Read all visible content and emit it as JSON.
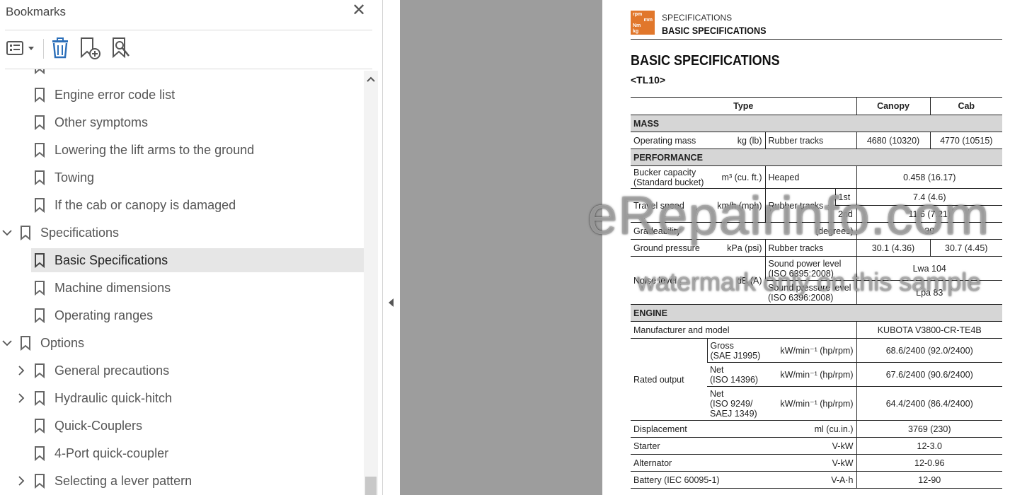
{
  "bookmarks_panel": {
    "title": "Bookmarks",
    "close_icon": "close-icon",
    "toolbar": {
      "options_icon": "list-options-icon",
      "delete_icon": "trash-icon",
      "new_bookmark_icon": "bookmark-add-icon",
      "bookmark_search_icon": "bookmark-search-icon"
    },
    "items": [
      {
        "label": "Engine error code list",
        "level": 1,
        "expander": "none",
        "selected": false
      },
      {
        "label": "Other symptoms",
        "level": 1,
        "expander": "none",
        "selected": false
      },
      {
        "label": "Lowering the lift arms to the ground",
        "level": 1,
        "expander": "none",
        "selected": false
      },
      {
        "label": "Towing",
        "level": 1,
        "expander": "none",
        "selected": false
      },
      {
        "label": "If the cab or canopy is damaged",
        "level": 1,
        "expander": "none",
        "selected": false
      },
      {
        "label": "Specifications",
        "level": 0,
        "expander": "expanded",
        "selected": false
      },
      {
        "label": "Basic Specifications",
        "level": 1,
        "expander": "none",
        "selected": true
      },
      {
        "label": "Machine dimensions",
        "level": 1,
        "expander": "none",
        "selected": false
      },
      {
        "label": "Operating ranges",
        "level": 1,
        "expander": "none",
        "selected": false
      },
      {
        "label": "Options",
        "level": 0,
        "expander": "expanded",
        "selected": false
      },
      {
        "label": "General precautions",
        "level": 1,
        "expander": "collapsed",
        "selected": false
      },
      {
        "label": "Hydraulic quick-hitch",
        "level": 1,
        "expander": "collapsed",
        "selected": false
      },
      {
        "label": "Quick-Couplers",
        "level": 1,
        "expander": "none",
        "selected": false
      },
      {
        "label": "4-Port quick-coupler",
        "level": 1,
        "expander": "none",
        "selected": false
      },
      {
        "label": "Selecting a lever pattern",
        "level": 1,
        "expander": "collapsed",
        "selected": false
      }
    ]
  },
  "colors": {
    "canvas_gray": "#9d9d9d",
    "header_icon_orange": "#e1772b",
    "section_band": "#d6d6d6",
    "selected_row": "#e6e6e6"
  },
  "document": {
    "header_icon_text": [
      "rpm",
      "mm",
      "Nm",
      "kg"
    ],
    "header_small": "SPECIFICATIONS",
    "header_big": "BASIC SPECIFICATIONS",
    "title": "BASIC SPECIFICATIONS",
    "model": "<TL10>",
    "table": {
      "col_type": "Type",
      "col_canopy": "Canopy",
      "col_cab": "Cab",
      "mass": {
        "section": "MASS",
        "op_mass": "Operating mass",
        "op_mass_unit": "kg (lb)",
        "op_mass_cond": "Rubber tracks",
        "op_mass_canopy": "4680 (10320)",
        "op_mass_cab": "4770 (10515)"
      },
      "performance": {
        "section": "PERFORMANCE",
        "bucket_label1": "Bucker capacity",
        "bucket_label2": "(Standard bucket)",
        "bucket_unit": "m³ (cu. ft.)",
        "bucket_cond": "Heaped",
        "bucket_value": "0.458 (16.17)",
        "travel_label": "Travel speed",
        "travel_unit": "km/h (mph)",
        "travel_cond": "Rubber tracks",
        "travel_1st": "1st",
        "travel_1st_value": "7.4 (4.6)",
        "travel_2nd": "2nd",
        "travel_2nd_value": "11.6 (7.21)",
        "grade_label": "Gradeability",
        "grade_unit": "(degrees)",
        "grade_value": "30",
        "ground_label": "Ground pressure",
        "ground_unit": "kPa (psi)",
        "ground_cond": "Rubber tracks",
        "ground_canopy": "30.1 (4.36)",
        "ground_cab": "30.7 (4.45)",
        "noise_label": "Noise level",
        "noise_unit": "dB (A)",
        "noise_power1": "Sound power level",
        "noise_power2": "(ISO 6395:2008)",
        "noise_power_value": "Lwa 104",
        "noise_pressure1": "Sound pressure level",
        "noise_pressure2": "(ISO 6396:2008)",
        "noise_pressure_value": "Lpa 83"
      },
      "engine": {
        "section": "ENGINE",
        "manuf_label": "Manufacturer and model",
        "manuf_value": "KUBOTA V3800-CR-TE4B",
        "rated_label": "Rated output",
        "gross1": "Gross",
        "gross2": "(SAE J1995)",
        "gross_unit": "kW/min⁻¹ (hp/rpm)",
        "gross_value": "68.6/2400 (92.0/2400)",
        "net1_a": "Net",
        "net1_b": "(ISO 14396)",
        "net1_unit": "kW/min⁻¹ (hp/rpm)",
        "net1_value": "67.6/2400 (90.6/2400)",
        "net2_a": "Net",
        "net2_b": "(ISO 9249/",
        "net2_c": "SAEJ 1349)",
        "net2_unit": "kW/min⁻¹ (hp/rpm)",
        "net2_value": "64.4/2400 (86.4/2400)",
        "disp_label": "Displacement",
        "disp_unit": "ml (cu.in.)",
        "disp_value": "3769 (230)",
        "starter_label": "Starter",
        "starter_unit": "V-kW",
        "starter_value": "12-3.0",
        "alt_label": "Alternator",
        "alt_unit": "V-kW",
        "alt_value": "12-0.96",
        "battery_label": "Battery (IEC 60095-1)",
        "battery_unit": "V-A·h",
        "battery_value": "12-90"
      }
    },
    "watermark_line1": "eRepairinfo.com",
    "watermark_line2": "watermark only on this sample"
  }
}
